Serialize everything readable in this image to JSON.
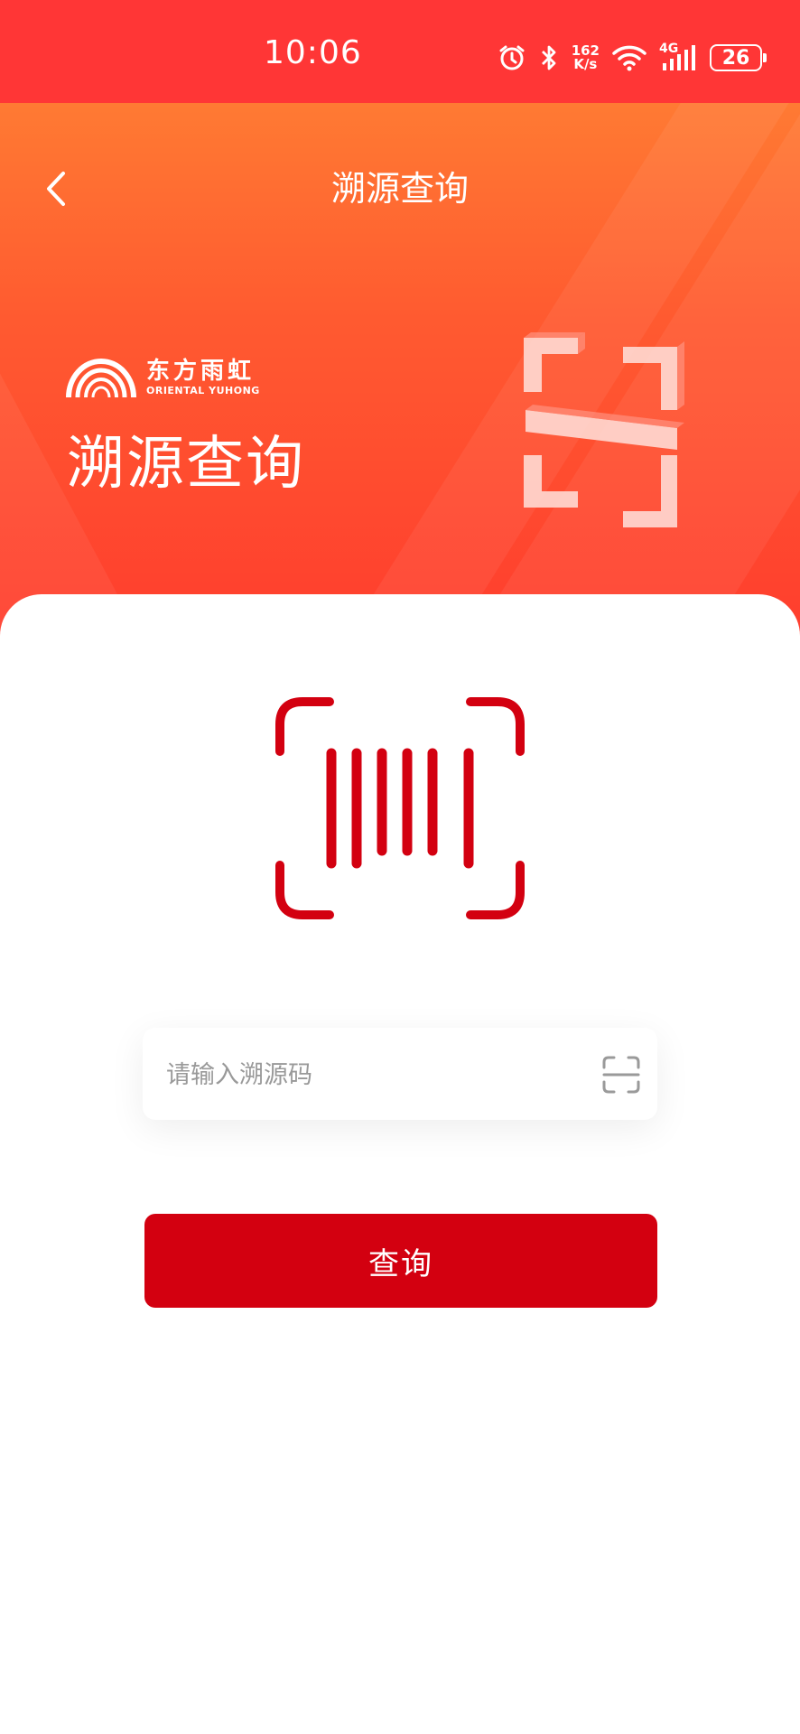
{
  "status_bar": {
    "time": "10:06",
    "net_speed_value": "162",
    "net_speed_unit": "K/s",
    "network_type": "4G",
    "battery": "26"
  },
  "nav": {
    "title": "溯源查询",
    "back_icon": "chevron-left-icon"
  },
  "hero": {
    "logo_cn": "东方雨虹",
    "logo_en": "ORIENTAL YUHONG",
    "title": "溯源查询"
  },
  "search": {
    "placeholder": "请输入溯源码",
    "value": "",
    "scan_icon": "scan-icon"
  },
  "actions": {
    "query_label": "查询"
  },
  "colors": {
    "status_bar": "#ff3636",
    "hero_top": "#ff7a33",
    "hero_bottom": "#ff3d2e",
    "brand_red": "#d30010"
  }
}
